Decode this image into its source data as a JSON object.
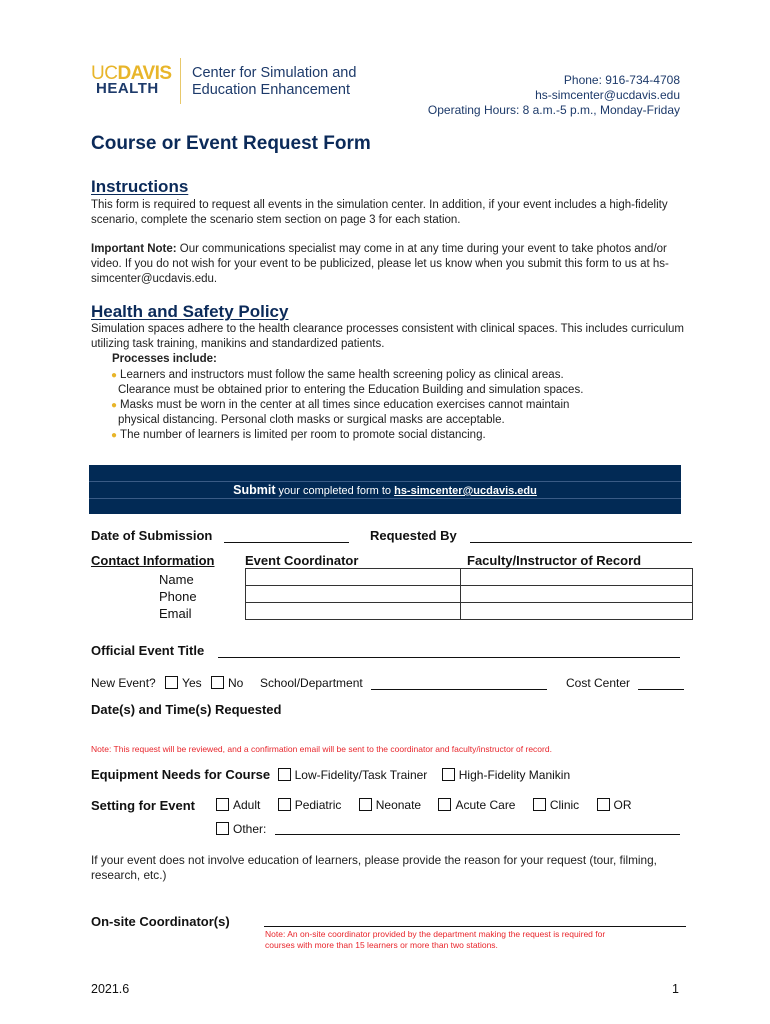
{
  "header": {
    "logo": {
      "uc": "UC",
      "davis": "DAVIS",
      "health": "HEALTH"
    },
    "center_name_line1": "Center for Simulation and",
    "center_name_line2": "Education Enhancement",
    "phone": "Phone: 916-734-4708",
    "email": "hs-simcenter@ucdavis.edu",
    "hours": "Operating Hours: 8 a.m.-5 p.m., Monday-Friday"
  },
  "title": "Course or Event Request Form",
  "instructions": {
    "heading": "Instructions",
    "text": "This form is required to request all events in the simulation center. In addition, if your event includes a high-fidelity scenario, complete the scenario stem section on page 3 for each station.",
    "note_label": "Important Note:",
    "note_text": " Our communications specialist may come in at any time during your event to take photos and/or video. If you do not wish for your event to be publicized, please let us know when you submit this form to us at hs-simcenter@ucdavis.edu."
  },
  "policy": {
    "heading": "Health and Safety Policy",
    "text": "Simulation spaces adhere to the health clearance processes consistent with clinical spaces. This includes curriculum utilizing task training, manikins and standardized patients.",
    "processes_label": "Processes include:",
    "bullets": [
      "Learners and instructors must follow the same health screening policy as clinical areas.",
      "Clearance must be obtained prior to entering the Education Building and simulation spaces.",
      "Masks must be worn in the center at all times since education exercises cannot maintain",
      "physical distancing. Personal cloth masks or surgical masks are acceptable.",
      "The number of learners is limited per room to promote social distancing."
    ]
  },
  "banner": {
    "submit": "Submit",
    "text": " your completed form to ",
    "email": "hs-simcenter@ucdavis.edu"
  },
  "form": {
    "date_of_submission": "Date of Submission",
    "requested_by": "Requested By",
    "contact_information": "Contact Information",
    "event_coordinator": "Event Coordinator",
    "faculty_instructor": "Faculty/Instructor of Record",
    "contact_rows": [
      "Name",
      "Phone",
      "Email"
    ],
    "official_event_title": "Official Event Title",
    "new_event": "New Event?",
    "yes": "Yes",
    "no": "No",
    "school_department": "School/Department",
    "cost_center": "Cost Center",
    "dates_times": "Date(s) and Time(s) Requested",
    "review_note": "Note: This request will be reviewed, and a confirmation email will be sent to the coordinator and faculty/instructor of record.",
    "equipment_label": "Equipment Needs for Course",
    "equipment_options": [
      "Low-Fidelity/Task Trainer",
      "High-Fidelity Manikin"
    ],
    "setting_label": "Setting for Event",
    "setting_options": [
      "Adult",
      "Pediatric",
      "Neonate",
      "Acute Care",
      "Clinic",
      "OR"
    ],
    "other_label": "Other:",
    "non_education_text": "If your event does not involve education of learners, please provide the reason for your request (tour, filming, research, etc.)",
    "onsite_label": "On-site Coordinator(s)",
    "onsite_note_line1": "Note: An on-site coordinator provided by the department making the request is required for",
    "onsite_note_line2": "courses with more than 15 learners or more than two stations."
  },
  "footer": {
    "version": "2021.6",
    "page": "1"
  },
  "colors": {
    "navy": "#0b2a59",
    "banner": "#022a55",
    "gold": "#e8b52a",
    "red_note": "#e8262c"
  }
}
